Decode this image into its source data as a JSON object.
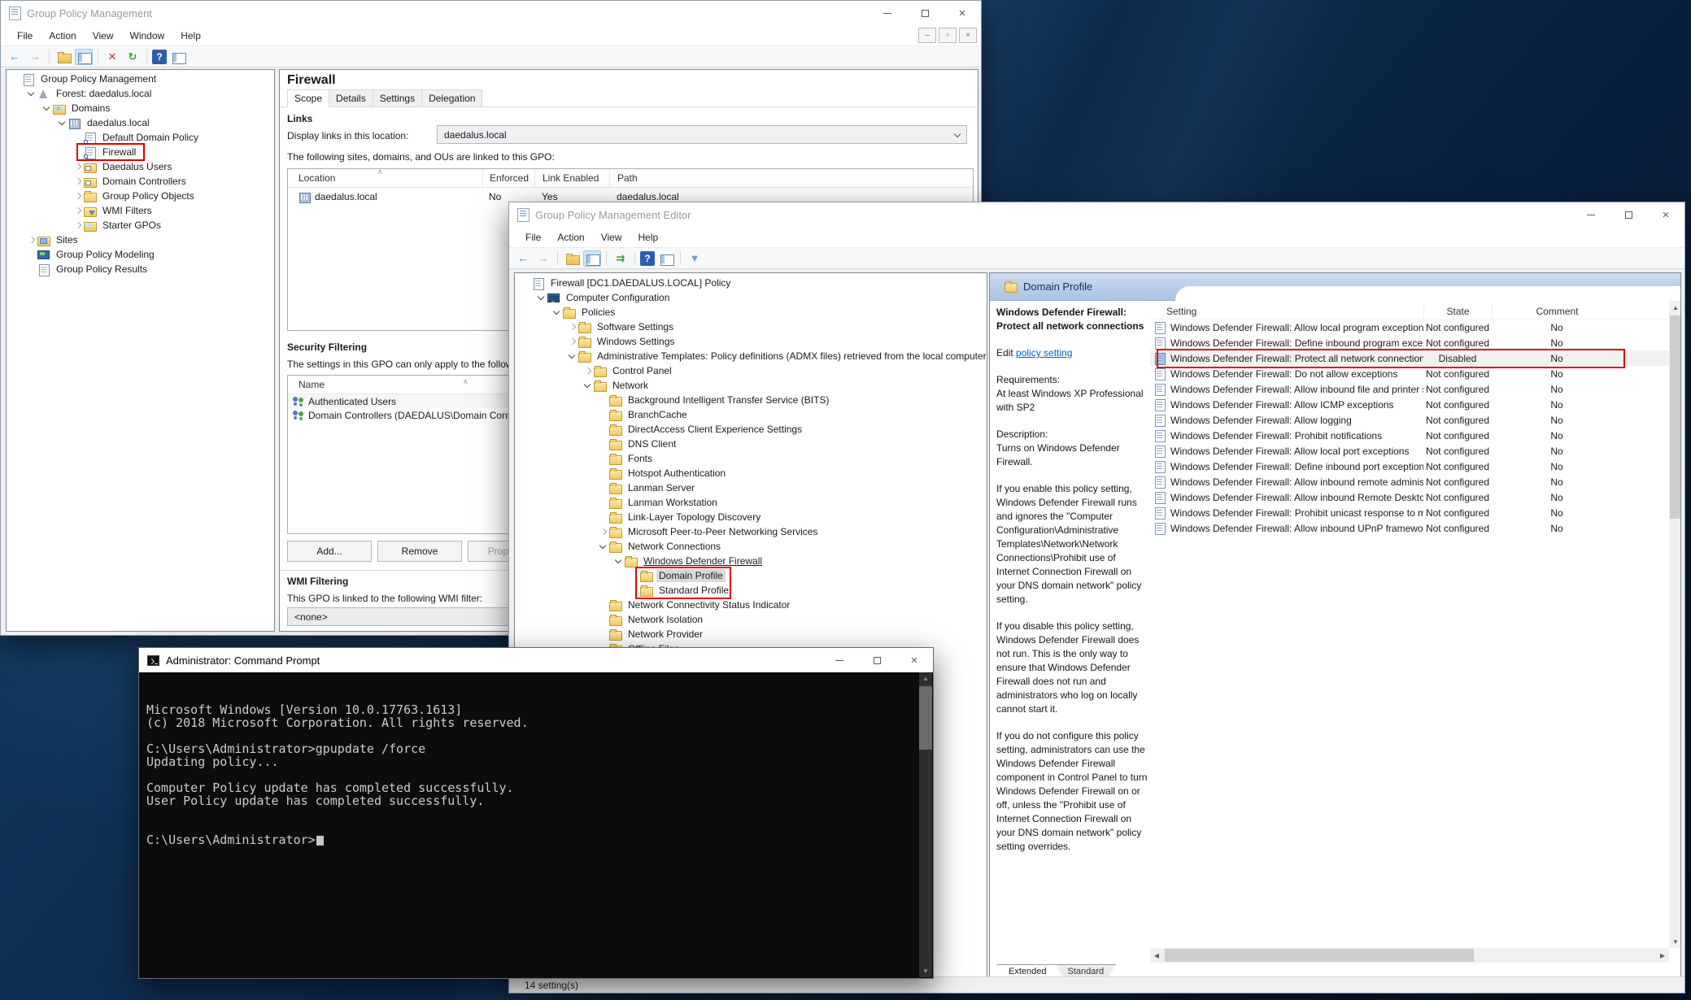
{
  "colors": {
    "annotation_red": "#e10000",
    "desktop_base": "#0e2e52",
    "console_bg": "#0c0c0c",
    "console_fg": "#cccccc",
    "header_band_blue": "#a9c3e4",
    "link_blue": "#0563c1",
    "selection_gray": "#d9d9d9"
  },
  "gpm": {
    "title": "Group Policy Management",
    "menu": [
      "File",
      "Action",
      "View",
      "Window",
      "Help"
    ],
    "toolbar": [
      "back",
      "forward",
      "sep",
      "up",
      "tree",
      "sep",
      "delete",
      "refresh",
      "sep",
      "help",
      "window"
    ],
    "tree": [
      {
        "label": "Group Policy Management",
        "level": 0,
        "icon": "console"
      },
      {
        "label": "Forest: daedalus.local",
        "level": 1,
        "arrow": "e",
        "icon": "forest"
      },
      {
        "label": "Domains",
        "level": 2,
        "arrow": "e",
        "icon": "domains"
      },
      {
        "label": "daedalus.local",
        "level": 3,
        "arrow": "e",
        "icon": "domain"
      },
      {
        "label": "Default Domain Policy",
        "level": 4,
        "icon": "gpo-link"
      },
      {
        "label": "Firewall",
        "level": 4,
        "icon": "gpo-link"
      },
      {
        "label": "Daedalus Users",
        "level": 4,
        "arrow": "c",
        "icon": "ou"
      },
      {
        "label": "Domain Controllers",
        "level": 4,
        "arrow": "c",
        "icon": "ou"
      },
      {
        "label": "Group Policy Objects",
        "level": 4,
        "arrow": "c",
        "icon": "folder"
      },
      {
        "label": "WMI Filters",
        "level": 4,
        "arrow": "c",
        "icon": "wmi"
      },
      {
        "label": "Starter GPOs",
        "level": 4,
        "arrow": "c",
        "icon": "starter"
      },
      {
        "label": "Sites",
        "level": 1,
        "arrow": "c",
        "icon": "sites"
      },
      {
        "label": "Group Policy Modeling",
        "level": 1,
        "icon": "modeling"
      },
      {
        "label": "Group Policy Results",
        "level": 1,
        "icon": "results"
      }
    ],
    "details": {
      "heading": "Firewall",
      "tabs": [
        "Scope",
        "Details",
        "Settings",
        "Delegation"
      ],
      "active_tab": 0,
      "links": {
        "title": "Links",
        "display_label": "Display links in this location:",
        "display_value": "daedalus.local",
        "caption": "The following sites, domains, and OUs are linked to this GPO:",
        "columns": [
          "Location",
          "Enforced",
          "Link Enabled",
          "Path"
        ],
        "rows": [
          {
            "location": "daedalus.local",
            "enforced": "No",
            "link_enabled": "Yes",
            "path": "daedalus.local"
          }
        ]
      },
      "security": {
        "title": "Security Filtering",
        "caption": "The settings in this GPO can only apply to the following groups, users, and computers:",
        "column": "Name",
        "rows": [
          "Authenticated Users",
          "Domain Controllers (DAEDALUS\\Domain Controllers)"
        ],
        "buttons": [
          {
            "label": "Add...",
            "enabled": true
          },
          {
            "label": "Remove",
            "enabled": true
          },
          {
            "label": "Properties",
            "enabled": false
          }
        ]
      },
      "wmi": {
        "title": "WMI Filtering",
        "caption": "This GPO is linked to the following WMI filter:",
        "value": "<none>"
      }
    }
  },
  "gpme": {
    "title": "Group Policy Management Editor",
    "menu": [
      "File",
      "Action",
      "View",
      "Help"
    ],
    "toolbar": [
      "back",
      "forward",
      "sep",
      "up",
      "tree",
      "sep",
      "export",
      "sep",
      "help",
      "window",
      "sep",
      "filter"
    ],
    "tree": [
      {
        "label": "Firewall [DC1.DAEDALUS.LOCAL] Policy",
        "level": 0,
        "icon": "gpo"
      },
      {
        "label": "Computer Configuration",
        "level": 1,
        "arrow": "e",
        "icon": "computer"
      },
      {
        "label": "Policies",
        "level": 2,
        "arrow": "e",
        "icon": "folder"
      },
      {
        "label": "Software Settings",
        "level": 3,
        "arrow": "c",
        "icon": "folder"
      },
      {
        "label": "Windows Settings",
        "level": 3,
        "arrow": "c",
        "icon": "folder"
      },
      {
        "label": "Administrative Templates: Policy definitions (ADMX files) retrieved from the local computer.",
        "level": 3,
        "arrow": "e",
        "icon": "folder"
      },
      {
        "label": "Control Panel",
        "level": 4,
        "arrow": "c",
        "icon": "folder"
      },
      {
        "label": "Network",
        "level": 4,
        "arrow": "e",
        "icon": "folder"
      },
      {
        "label": "Background Intelligent Transfer Service (BITS)",
        "level": 5,
        "icon": "folder"
      },
      {
        "label": "BranchCache",
        "level": 5,
        "icon": "folder"
      },
      {
        "label": "DirectAccess Client Experience Settings",
        "level": 5,
        "icon": "folder"
      },
      {
        "label": "DNS Client",
        "level": 5,
        "icon": "folder"
      },
      {
        "label": "Fonts",
        "level": 5,
        "icon": "folder"
      },
      {
        "label": "Hotspot Authentication",
        "level": 5,
        "icon": "folder"
      },
      {
        "label": "Lanman Server",
        "level": 5,
        "icon": "folder"
      },
      {
        "label": "Lanman Workstation",
        "level": 5,
        "icon": "folder"
      },
      {
        "label": "Link-Layer Topology Discovery",
        "level": 5,
        "icon": "folder"
      },
      {
        "label": "Microsoft Peer-to-Peer Networking Services",
        "level": 5,
        "arrow": "c",
        "icon": "folder"
      },
      {
        "label": "Network Connections",
        "level": 5,
        "arrow": "e",
        "icon": "folder"
      },
      {
        "label": "Windows Defender Firewall",
        "level": 6,
        "arrow": "e",
        "icon": "folder",
        "underline": true
      },
      {
        "label": "Domain Profile",
        "level": 7,
        "icon": "folder",
        "selected": true
      },
      {
        "label": "Standard Profile",
        "level": 7,
        "icon": "folder"
      },
      {
        "label": "Network Connectivity Status Indicator",
        "level": 5,
        "icon": "folder"
      },
      {
        "label": "Network Isolation",
        "level": 5,
        "icon": "folder"
      },
      {
        "label": "Network Provider",
        "level": 5,
        "icon": "folder"
      },
      {
        "label": "Offline Files",
        "level": 5,
        "icon": "folder"
      }
    ],
    "details": {
      "header": "Domain Profile",
      "policy_title": "Windows Defender Firewall: Protect all network connections",
      "edit_prefix": "Edit ",
      "edit_link": "policy setting",
      "requirements_label": "Requirements:",
      "requirements_text": "At least Windows XP Professional with SP2",
      "description_label": "Description:",
      "paragraphs": [
        "Turns on Windows Defender Firewall.",
        "If you enable this policy setting, Windows Defender Firewall runs and ignores the \"Computer Configuration\\Administrative Templates\\Network\\Network Connections\\Prohibit use of Internet Connection Firewall on your DNS domain network\" policy setting.",
        "If you disable this policy setting, Windows Defender Firewall does not run. This is the only way to ensure that Windows Defender Firewall does not run and administrators who log on locally cannot start it.",
        "If you do not configure this policy setting, administrators can use the Windows Defender Firewall component in Control Panel to turn Windows Defender Firewall on or off, unless the \"Prohibit use of Internet Connection Firewall on your DNS domain network\" policy setting overrides."
      ],
      "columns": [
        "Setting",
        "State",
        "Comment"
      ],
      "rows": [
        {
          "setting": "Windows Defender Firewall: Allow local program exceptions",
          "state": "Not configured",
          "comment": "No"
        },
        {
          "setting": "Windows Defender Firewall: Define inbound program except...",
          "state": "Not configured",
          "comment": "No"
        },
        {
          "setting": "Windows Defender Firewall: Protect all network connections",
          "state": "Disabled",
          "comment": "No",
          "selected": true
        },
        {
          "setting": "Windows Defender Firewall: Do not allow exceptions",
          "state": "Not configured",
          "comment": "No"
        },
        {
          "setting": "Windows Defender Firewall: Allow inbound file and printer s...",
          "state": "Not configured",
          "comment": "No"
        },
        {
          "setting": "Windows Defender Firewall: Allow ICMP exceptions",
          "state": "Not configured",
          "comment": "No"
        },
        {
          "setting": "Windows Defender Firewall: Allow logging",
          "state": "Not configured",
          "comment": "No"
        },
        {
          "setting": "Windows Defender Firewall: Prohibit notifications",
          "state": "Not configured",
          "comment": "No"
        },
        {
          "setting": "Windows Defender Firewall: Allow local port exceptions",
          "state": "Not configured",
          "comment": "No"
        },
        {
          "setting": "Windows Defender Firewall: Define inbound port exceptions",
          "state": "Not configured",
          "comment": "No"
        },
        {
          "setting": "Windows Defender Firewall: Allow inbound remote administ...",
          "state": "Not configured",
          "comment": "No"
        },
        {
          "setting": "Windows Defender Firewall: Allow inbound Remote Desktop...",
          "state": "Not configured",
          "comment": "No"
        },
        {
          "setting": "Windows Defender Firewall: Prohibit unicast response to mu...",
          "state": "Not configured",
          "comment": "No"
        },
        {
          "setting": "Windows Defender Firewall: Allow inbound UPnP framewor...",
          "state": "Not configured",
          "comment": "No"
        }
      ],
      "view_tabs": [
        "Extended",
        "Standard"
      ],
      "status": "14 setting(s)"
    }
  },
  "cmd": {
    "title": "Administrator: Command Prompt",
    "cursor": true,
    "lines": [
      "Microsoft Windows [Version 10.0.17763.1613]",
      "(c) 2018 Microsoft Corporation. All rights reserved.",
      "",
      "C:\\Users\\Administrator>gpupdate /force",
      "Updating policy...",
      "",
      "Computer Policy update has completed successfully.",
      "User Policy update has completed successfully.",
      "",
      "",
      "C:\\Users\\Administrator>"
    ]
  }
}
